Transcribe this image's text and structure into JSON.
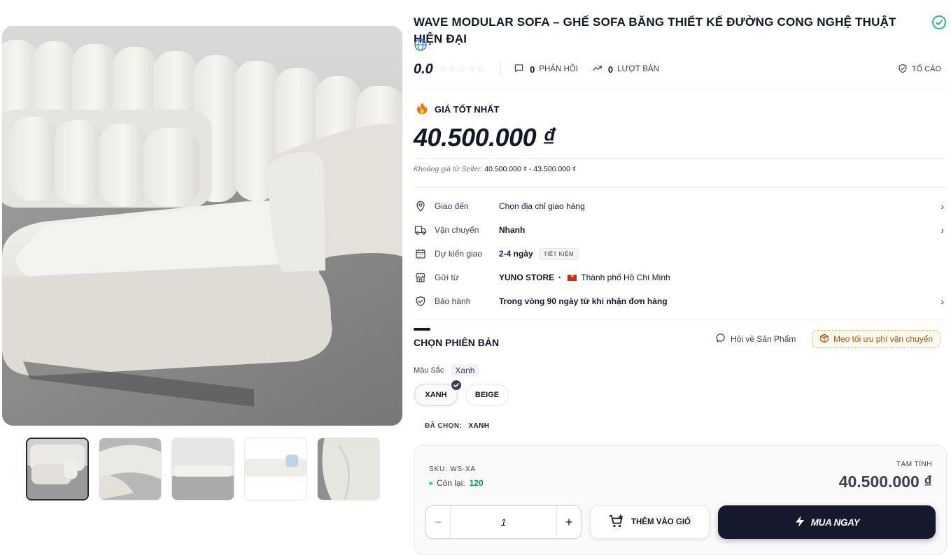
{
  "product": {
    "title": "WAVE MODULAR SOFA – GHẾ SOFA BĂNG THIẾT KẾ ĐƯỜNG CONG NGHỆ THUẬT HIỆN ĐẠI",
    "rating": "0.0",
    "stars": "☆☆☆☆☆",
    "reviews_count": "0",
    "reviews_label": "PHẢN HỒI",
    "sold_count": "0",
    "sold_label": "LƯỢT BÁN",
    "report_label": "TỐ CÁO"
  },
  "pricing": {
    "best_label": "GIÁ TỐT NHẤT",
    "price": "40.500.000 ₫",
    "range_label": "Khoảng giá từ Seller:",
    "range_value": "40.500.000 ₫ - 43.500.000 ₫"
  },
  "shipping": {
    "deliver_to_label": "Giao đến",
    "deliver_to_value": "Chọn địa chỉ giao hàng",
    "carrier_label": "Vận chuyển",
    "carrier_value": "Nhanh",
    "eta_label": "Dự kiến giao",
    "eta_value": "2-4 ngày",
    "eta_badge": "TIẾT KIỆM",
    "from_label": "Gửi từ",
    "store_name": "YUNO STORE",
    "separator": "•",
    "city": "Thành phố Hồ Chí Minh",
    "warranty_label": "Bảo hành",
    "warranty_value": "Trong vòng 90 ngày từ khi nhận đơn hàng"
  },
  "variants": {
    "section_title": "CHỌN PHIÊN BẢN",
    "ask_label": "Hỏi về Sản Phẩm",
    "tip_label": "Mẹo tối ưu phí vận chuyển",
    "color_label": "Màu Sắc",
    "color_value": "Xanh",
    "options": [
      "XANH",
      "BEIGE"
    ],
    "selected_index": 0,
    "chosen_label": "ĐÃ CHỌN:",
    "chosen_value": "XANH"
  },
  "summary": {
    "sku": "SKU: WS-XA",
    "stock_label": "Còn lại:",
    "stock_value": "120",
    "subtotal_label": "TẠM TÍNH",
    "subtotal_value": "40.500.000 ₫",
    "quantity": "1",
    "minus": "−",
    "plus": "+",
    "add_to_cart_label": "THÊM VÀO GIỎ",
    "buy_now_label": "MUA NGAY"
  },
  "gallery": {
    "thumbnail_count": 5,
    "active_index": 0
  },
  "colors": {
    "dark": "#141a2b",
    "stock_green": "#059669",
    "verified_green": "#10b981",
    "tip_orange": "#b45309",
    "fire": "#f97316"
  }
}
